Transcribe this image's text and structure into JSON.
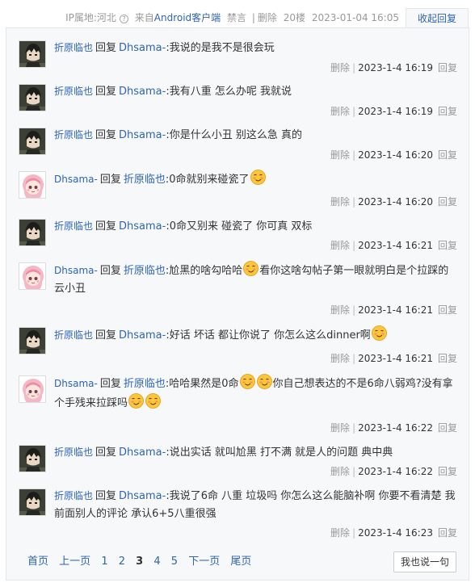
{
  "topbar": {
    "ip_label": "IP属地:河北",
    "from_prefix": "来自",
    "from_client": "Android客户端",
    "ban": "禁言",
    "delete": "删除",
    "floor": "20楼",
    "time": "2023-01-04 16:05",
    "collapse": "收起回复"
  },
  "common": {
    "reply_word": "回复",
    "delete": "删除",
    "reply_action": "回复",
    "separator": "|"
  },
  "replies": [
    {
      "user": "折原临也",
      "target": "Dhsama-",
      "avatar": "boy",
      "parts": [
        {
          "t": ":我说的是我不是很会玩"
        }
      ],
      "time": "2023-1-4 16:19"
    },
    {
      "user": "折原临也",
      "target": "Dhsama-",
      "avatar": "boy",
      "parts": [
        {
          "t": ":我有八重 怎么办呢 我就说"
        }
      ],
      "time": "2023-1-4 16:19"
    },
    {
      "user": "折原临也",
      "target": "Dhsama-",
      "avatar": "boy",
      "parts": [
        {
          "t": ":你是什么小丑 别这么急 真的"
        }
      ],
      "time": "2023-1-4 16:20"
    },
    {
      "user": "Dhsama-",
      "target": "折原临也",
      "avatar": "girl",
      "parts": [
        {
          "t": ":0命就别来碰瓷了"
        },
        {
          "e": "smirk-emoji"
        }
      ],
      "time": "2023-1-4 16:20"
    },
    {
      "user": "折原临也",
      "target": "Dhsama-",
      "avatar": "boy",
      "parts": [
        {
          "t": ":0命又别来 碰瓷了 你可真 双标"
        }
      ],
      "time": "2023-1-4 16:21"
    },
    {
      "user": "Dhsama-",
      "target": "折原临也",
      "avatar": "girl",
      "parts": [
        {
          "t": ":尬黑的啥勾哈哈"
        },
        {
          "e": "smirk-emoji"
        },
        {
          "t": "看你这啥勾帖子第一眼就明白是个拉踩的云小丑"
        }
      ],
      "time": "2023-1-4 16:21"
    },
    {
      "user": "折原临也",
      "target": "Dhsama-",
      "avatar": "boy",
      "parts": [
        {
          "t": ":好话 坏话 都让你说了 你怎么这么dinner啊"
        },
        {
          "e": "smirk-emoji"
        }
      ],
      "time": "2023-1-4 16:21"
    },
    {
      "user": "Dhsama-",
      "target": "折原临也",
      "avatar": "girl",
      "parts": [
        {
          "t": ":哈哈果然是0命"
        },
        {
          "e": "smirk-emoji"
        },
        {
          "e": "smirk-emoji"
        },
        {
          "t": "你自己想表达的不是6命八弱鸡?没有拿个手残来拉踩吗"
        },
        {
          "e": "smirk-emoji"
        },
        {
          "e": "smirk-emoji"
        }
      ],
      "time": "2023-1-4 16:22"
    },
    {
      "user": "折原临也",
      "target": "Dhsama-",
      "avatar": "boy",
      "parts": [
        {
          "t": ":说出实话 就叫尬黑 打不满 就是人的问题 典中典"
        }
      ],
      "time": "2023-1-4 16:22"
    },
    {
      "user": "折原临也",
      "target": "Dhsama-",
      "avatar": "boy",
      "parts": [
        {
          "t": ":我说了6命 八重 垃圾吗 你怎么这么能脑补啊 你要不看清楚 我前面别人的评论 承认6+5八重很强"
        }
      ],
      "time": "2023-1-4 16:23"
    }
  ],
  "pager": {
    "first": "首页",
    "prev": "上一页",
    "pages": [
      "1",
      "2",
      "3",
      "4",
      "5"
    ],
    "current": "3",
    "next": "下一页",
    "last": "尾页"
  },
  "say_button": "我也说一句",
  "colors": {
    "link": "#2d64b3",
    "panel_bg": "#f7f8fa",
    "border": "#e4e6eb",
    "meta": "#999999"
  }
}
